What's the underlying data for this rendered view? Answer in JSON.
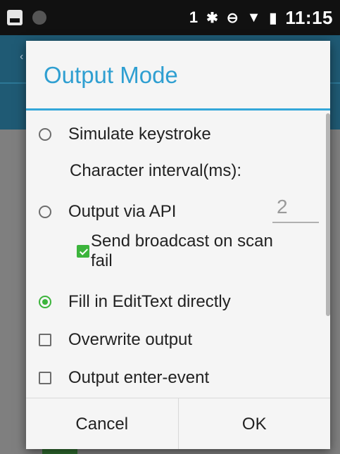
{
  "status_bar": {
    "sim_icon": "sim-1-icon",
    "sim_label": "1",
    "bluetooth_icon": "bluetooth-icon",
    "bluetooth_glyph": "✱",
    "dnd_icon": "do-not-disturb-icon",
    "dnd_glyph": "⊖",
    "wifi_icon": "wifi-icon",
    "wifi_glyph": "▼",
    "battery_icon": "battery-icon",
    "battery_glyph": "▮",
    "time": "11:15"
  },
  "dialog": {
    "title": "Output Mode",
    "options": {
      "simulate_keystroke": {
        "label": "Simulate keystroke",
        "checked": false
      },
      "character_interval": {
        "label": "Character interval(ms):",
        "value": "2"
      },
      "output_via_api": {
        "label": "Output via API",
        "checked": false
      },
      "send_broadcast": {
        "label_line1": "Send broadcast on scan",
        "label_line2": "fail",
        "checked": true
      },
      "fill_edittext": {
        "label": "Fill in EditText directly",
        "checked": true
      },
      "overwrite_output": {
        "label": "Overwrite output",
        "checked": false
      },
      "output_enter_event": {
        "label": "Output enter-event",
        "checked": false
      }
    },
    "buttons": {
      "cancel": "Cancel",
      "ok": "OK"
    }
  },
  "colors": {
    "accent": "#2f9fd1",
    "check_green": "#3cb43c"
  }
}
